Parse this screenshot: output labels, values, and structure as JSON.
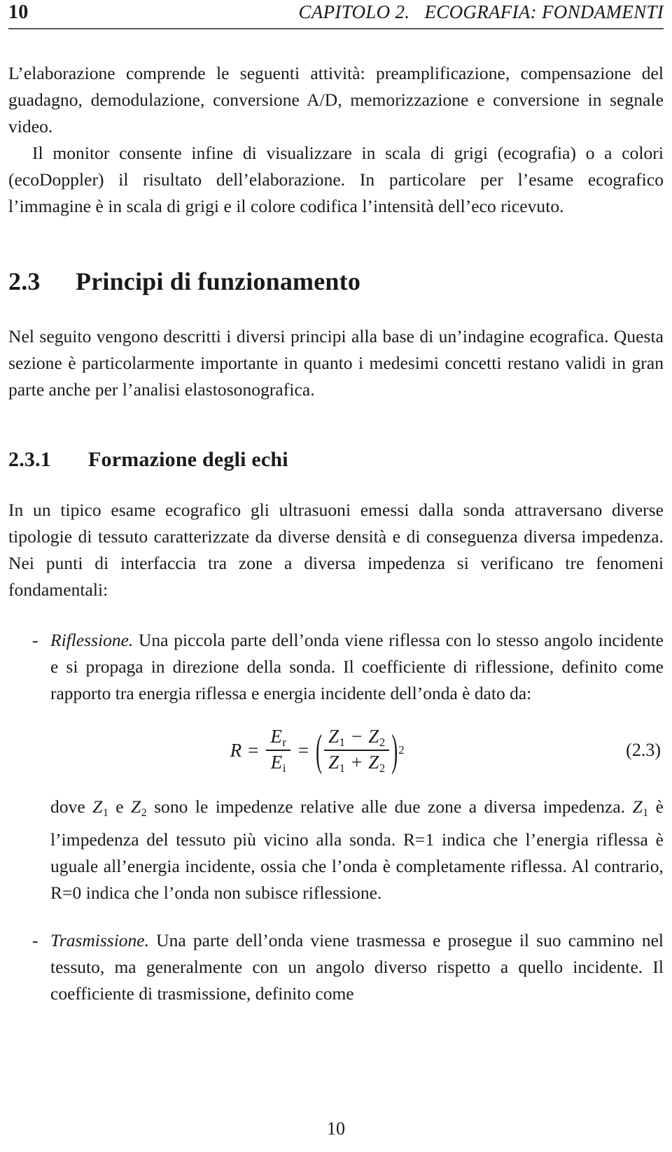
{
  "header": {
    "folio": "10",
    "title": "CAPITOLO 2.   ECOGRAFIA: FONDAMENTI"
  },
  "body": {
    "paragraph_1": "L’elaborazione comprende le seguenti attività: preamplificazione, compensazione del guadagno, demodulazione, conversione A/D, memorizzazione e conversione in segnale video.",
    "paragraph_2": "Il monitor consente infine di visualizzare in scala di grigi (ecografia) o a colori (ecoDoppler) il risultato dell’elaborazione. In particolare per l’esame ecografico l’immagine è in scala di grigi e il colore codifica l’intensità dell’eco ricevuto."
  },
  "section": {
    "number": "2.3",
    "title": "Principi di funzionamento",
    "intro": "Nel seguito vengono descritti i diversi principi alla base di un’indagine ecografica. Questa sezione è particolarmente importante in quanto i medesimi concetti restano validi in gran parte anche per l’analisi elastosonografica."
  },
  "subsection": {
    "number": "2.3.1",
    "title": "Formazione degli echi",
    "intro": "In un tipico esame ecografico gli ultrasuoni emessi dalla sonda attraversano diverse tipologie di tessuto caratterizzate da diverse densità e di conseguenza diversa impedenza. Nei punti di interfaccia tra zone a diversa impedenza si verificano tre fenomeni fondamentali:"
  },
  "list": {
    "marker": "-",
    "items": [
      {
        "lead": "Riflessione.",
        "text": " Una piccola parte dell’onda viene riflessa con lo stesso angolo incidente e si propaga in direzione della sonda. Il coefficiente di riflessione, definito come rapporto tra energia riflessa e energia incidente dell’onda è dato da:"
      },
      {
        "lead": "Trasmissione.",
        "text": " Una parte dell’onda viene trasmessa e prosegue il suo cammino nel tessuto, ma generalmente con un angolo diverso rispetto a quello incidente. Il coefficiente di trasmissione, definito come"
      }
    ]
  },
  "equation": {
    "tag": "(2.3)",
    "lhs": "R",
    "eq1": "=",
    "frac1_num_base": "E",
    "frac1_num_sub": "r",
    "frac1_den_base": "E",
    "frac1_den_sub": "i",
    "eq2": "=",
    "open_paren": "(",
    "frac2_num": "Z₁ − Z₂",
    "frac2_num_a": "Z",
    "frac2_num_a_sub": "1",
    "frac2_num_op": "−",
    "frac2_num_b": "Z",
    "frac2_num_b_sub": "2",
    "frac2_den_a": "Z",
    "frac2_den_a_sub": "1",
    "frac2_den_op": "+",
    "frac2_den_b": "Z",
    "frac2_den_b_sub": "2",
    "close_paren": ")",
    "exponent": "2",
    "plain_text": "R = E_r / E_i = ((Z1 - Z2)/(Z1 + Z2))^2"
  },
  "after_equation": {
    "part_1": "dove ",
    "var_z1": "Z",
    "var_z1_sub": "1",
    "part_2": " e ",
    "var_z2": "Z",
    "var_z2_sub": "2",
    "part_3": " sono le impedenze relative alle due zone a diversa impedenza. ",
    "var_z1b": "Z",
    "var_z1b_sub": "1",
    "part_4": " è l’impedenza del tessuto più vicino alla sonda. R=1 indica che l’energia riflessa è uguale all’energia incidente, ossia che l’onda è completamente riflessa. Al contrario, R=0 indica che l’onda non subisce riflessione."
  },
  "footer": {
    "page_number": "10"
  },
  "colors": {
    "text": "#1a1a1a",
    "rule": "#555a60",
    "background": "#ffffff"
  }
}
